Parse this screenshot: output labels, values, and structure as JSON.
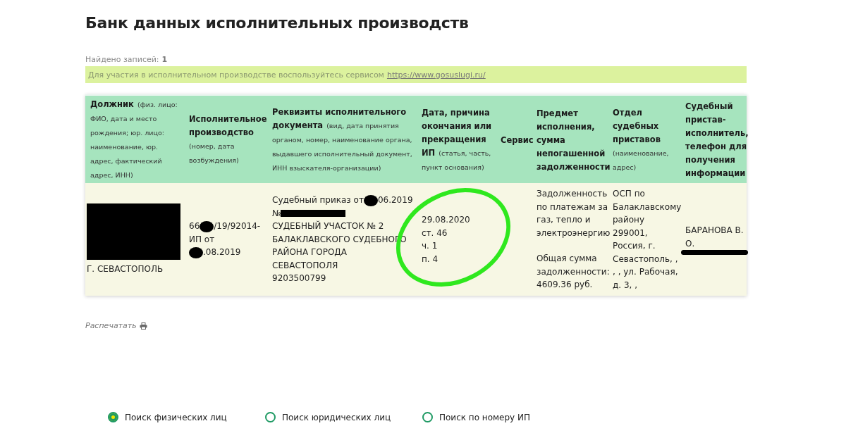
{
  "page_title": "Банк данных исполнительных производств",
  "found": {
    "label": "Найдено записей:",
    "count": "1"
  },
  "notice": {
    "text": "Для участия в исполнительном производстве воспользуйтесь сервисом",
    "link": "https://www.gosuslugi.ru/"
  },
  "table": {
    "columns": [
      {
        "title": "Должник",
        "note": "(физ. лицо: ФИО, дата и место рождения; юр. лицо: наименование, юр. адрес, фактический адрес, ИНН)"
      },
      {
        "title": "Исполнительное производство",
        "note": "(номер, дата возбуждения)"
      },
      {
        "title": "Реквизиты исполнительного документа",
        "note": "(вид, дата принятия органом, номер, наименование органа, выдавшего исполнительный документ, ИНН взыскателя-организации)"
      },
      {
        "title": "Дата, причина окончания или прекращения ИП",
        "note": "(статья, часть, пункт основания)"
      },
      {
        "title": "Сервис"
      },
      {
        "title": "Предмет исполнения, сумма непогашенной задолженности"
      },
      {
        "title": "Отдел судебных приставов",
        "note": "(наименование, адрес)"
      },
      {
        "title": "Судебный пристав-исполнитель, телефон для получения информации"
      }
    ],
    "rows": [
      {
        "cells": [
          {
            "circled": false,
            "paragraphs": [
              [
                {
                  "segments": [
                    {
                      "kind": "block"
                    }
                  ]
                },
                {
                  "text": "Г. СЕВАСТОПОЛЬ"
                }
              ]
            ]
          },
          {
            "circled": false,
            "paragraphs": [
              [
                {
                  "segments": [
                    {
                      "kind": "text",
                      "text": "66"
                    },
                    {
                      "kind": "blot"
                    },
                    {
                      "kind": "text",
                      "text": "/19/92014-"
                    }
                  ]
                },
                {
                  "text": "ИП от"
                },
                {
                  "segments": [
                    {
                      "kind": "blot"
                    },
                    {
                      "kind": "text",
                      "text": ".08.2019"
                    }
                  ]
                }
              ]
            ]
          },
          {
            "circled": false,
            "paragraphs": [
              [
                {
                  "segments": [
                    {
                      "kind": "text",
                      "text": "Судебный приказ от"
                    },
                    {
                      "kind": "blot"
                    },
                    {
                      "kind": "text",
                      "text": "06.2019"
                    }
                  ]
                },
                {
                  "segments": [
                    {
                      "kind": "text",
                      "text": "№"
                    },
                    {
                      "kind": "bar"
                    }
                  ]
                },
                {
                  "text": "СУДЕБНЫЙ УЧАСТОК № 2"
                },
                {
                  "text": "БАЛАКЛАВСКОГО СУДЕБНОГО"
                },
                {
                  "text": "РАЙОНА ГОРОДА"
                },
                {
                  "text": "СЕВАСТОПОЛЯ"
                },
                {
                  "text": "9203500799"
                }
              ]
            ]
          },
          {
            "circled": true,
            "paragraphs": [
              [
                {
                  "text": "29.08.2020"
                },
                {
                  "text": "ст. 46"
                },
                {
                  "text": "ч. 1"
                },
                {
                  "text": "п. 4"
                }
              ]
            ]
          },
          {
            "circled": false
          },
          {
            "circled": false,
            "paragraphs": [
              [
                {
                  "text": "Задолженность"
                },
                {
                  "text": "по платежам за"
                },
                {
                  "text": "газ, тепло и"
                },
                {
                  "text": "электроэнергию"
                }
              ],
              [
                {
                  "text": "Общая сумма"
                },
                {
                  "text": "задолженности:"
                },
                {
                  "text": "4609.36 руб."
                }
              ]
            ]
          },
          {
            "circled": false,
            "paragraphs": [
              [
                {
                  "text": "ОСП по"
                },
                {
                  "text": "Балаклавскому"
                },
                {
                  "text": "району"
                },
                {
                  "text": "299001,"
                },
                {
                  "text": "Россия, г."
                },
                {
                  "text": "Севастополь, ,"
                },
                {
                  "text": ", , ул. Рабочая,"
                },
                {
                  "text": "д. 3, ,"
                }
              ]
            ]
          },
          {
            "circled": false,
            "paragraphs": [
              [
                {
                  "text": "БАРАНОВА В."
                },
                {
                  "text": "О."
                },
                {
                  "segments": [
                    {
                      "kind": "scribble"
                    }
                  ]
                }
              ]
            ]
          }
        ]
      }
    ]
  },
  "print_link": "Распечатать",
  "search_modes": [
    {
      "label": "Поиск физических лиц",
      "selected": true
    },
    {
      "label": "Поиск юридических лиц",
      "selected": false
    },
    {
      "label": "Поиск по номеру ИП",
      "selected": false
    }
  ]
}
